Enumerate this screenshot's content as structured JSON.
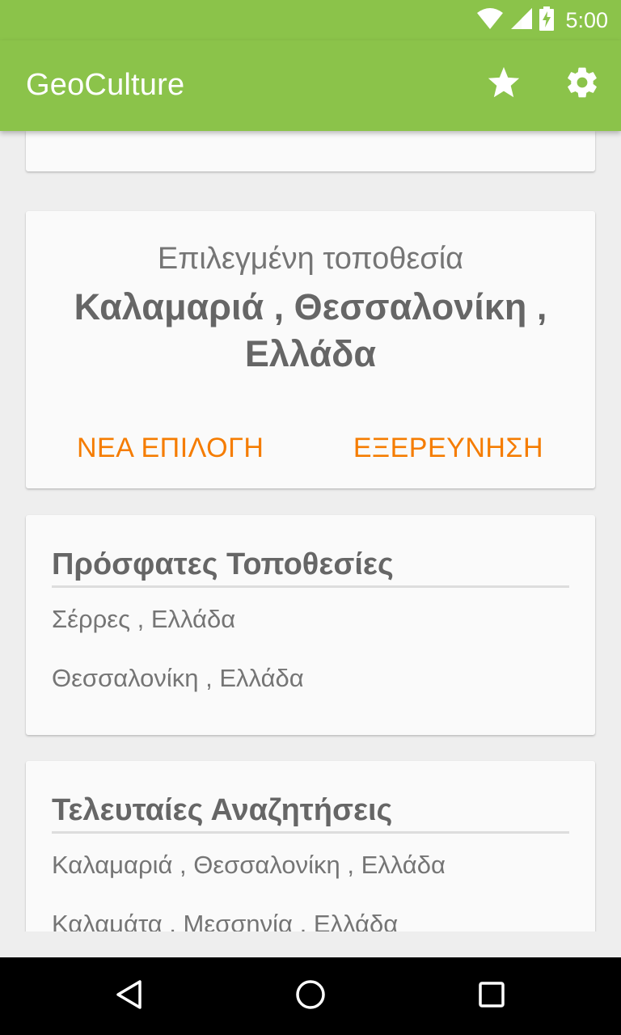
{
  "status_bar": {
    "time": "5:00",
    "icons": [
      "wifi-icon",
      "signal-icon",
      "battery-charging-icon"
    ]
  },
  "app_bar": {
    "title": "GeoCulture",
    "actions": [
      "star-icon",
      "settings-gear-icon"
    ]
  },
  "selected_location": {
    "label": "Επιλεγμένη τοποθεσία",
    "name": "Καλαμαριά , Θεσσαλονίκη , Ελλάδα",
    "new_selection_button": "ΝΕΑ ΕΠΙΛΟΓΗ",
    "explore_button": "ΕΞΕΡΕΥΝΗΣΗ"
  },
  "recent_locations": {
    "title": "Πρόσφατες Τοποθεσίες",
    "items": [
      "Σέρρες , Ελλάδα",
      "Θεσσαλονίκη , Ελλάδα"
    ]
  },
  "last_searches": {
    "title": "Τελευταίες Αναζητήσεις",
    "items": [
      "Καλαμαριά , Θεσσαλονίκη , Ελλάδα",
      "Καλαμάτα , Μεσσηνία , Ελλάδα"
    ]
  },
  "nav_bar": {
    "buttons": [
      "back-icon",
      "home-icon",
      "recents-icon"
    ]
  },
  "colors": {
    "primary": "#8bc34a",
    "accent": "#f57c00",
    "background": "#eeeeee",
    "card": "#fafafa",
    "text": "#757575"
  }
}
